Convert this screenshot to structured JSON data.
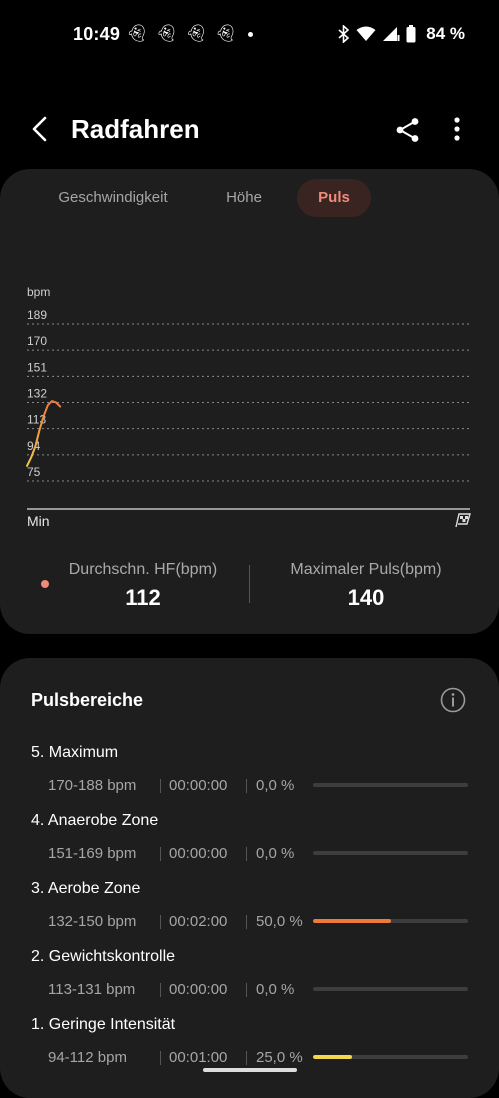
{
  "status_bar": {
    "time": "10:49",
    "battery": "84 %",
    "notification_icons": [
      "snapchat-icon",
      "snapchat-icon",
      "snapchat-icon",
      "snapchat-icon"
    ]
  },
  "header": {
    "title": "Radfahren"
  },
  "tabs": [
    {
      "label": "Geschwindigkeit",
      "active": false
    },
    {
      "label": "Höhe",
      "active": false
    },
    {
      "label": "Puls",
      "active": true
    }
  ],
  "chart_data": {
    "type": "line",
    "ylabel": "bpm",
    "xlabel": "Min",
    "yticks": [
      "189",
      "170",
      "151",
      "132",
      "113",
      "94",
      "75"
    ],
    "ylim": [
      75,
      189
    ],
    "x": [
      0,
      0.5,
      1,
      1.5,
      2,
      2.5,
      3,
      3.5,
      4
    ],
    "series": [
      {
        "values": [
          86,
          92,
          100,
          112,
          122,
          130,
          133,
          132,
          129
        ]
      }
    ],
    "colors": [
      "#f2c744",
      "#f07a3a"
    ]
  },
  "stats": {
    "avg_label": "Durchschn. HF(bpm)",
    "avg_value": "112",
    "max_label": "Maximaler Puls(bpm)",
    "max_value": "140"
  },
  "zones": {
    "title": "Pulsbereiche",
    "items": [
      {
        "name": "5. Maximum",
        "range": "170-188 bpm",
        "time": "00:00:00",
        "percent": "0,0 %",
        "fraction": 0,
        "color": "#f07a3a"
      },
      {
        "name": "4. Anaerobe Zone",
        "range": "151-169 bpm",
        "time": "00:00:00",
        "percent": "0,0 %",
        "fraction": 0,
        "color": "#f07a3a"
      },
      {
        "name": "3. Aerobe Zone",
        "range": "132-150 bpm",
        "time": "00:02:00",
        "percent": "50,0 %",
        "fraction": 0.5,
        "color": "#f07a3a"
      },
      {
        "name": "2. Gewichtskontrolle",
        "range": "113-131 bpm",
        "time": "00:00:00",
        "percent": "0,0 %",
        "fraction": 0,
        "color": "#f2c744"
      },
      {
        "name": "1. Geringe Intensität",
        "range": "94-112 bpm",
        "time": "00:01:00",
        "percent": "25,0 %",
        "fraction": 0.25,
        "color": "#f2d84a"
      }
    ]
  }
}
